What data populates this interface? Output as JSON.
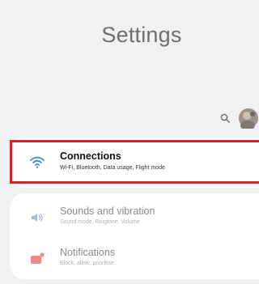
{
  "header": {
    "title": "Settings"
  },
  "toolbar": {
    "search_icon": "search-icon",
    "avatar_icon": "avatar"
  },
  "settings_items": [
    {
      "label": "Connections",
      "subtitle": "Wi-Fi, Bluetooth, Data usage, Flight mode",
      "icon": "wifi-icon",
      "icon_color": "#3b8be0",
      "highlighted": true,
      "highlight_color": "#d5212b"
    },
    {
      "label": "Sounds and vibration",
      "subtitle": "Sound mode, Ringtone, Volume",
      "icon": "speaker-icon",
      "icon_color": "#a9b4e8"
    },
    {
      "label": "Notifications",
      "subtitle": "Block, allow, prioritise",
      "icon": "notification-icon",
      "icon_color": "#f08a8a"
    }
  ]
}
